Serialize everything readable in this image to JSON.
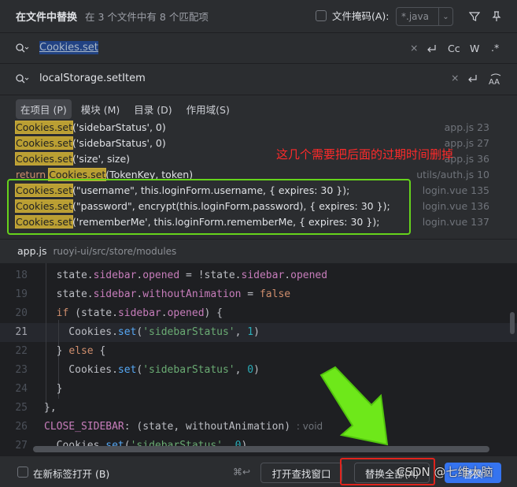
{
  "header": {
    "title": "在文件中替换",
    "subtitle": "在 3 个文件中有 8 个匹配项",
    "file_mask_label": "文件掩码(A):",
    "file_mask_value": "*.java"
  },
  "find": {
    "query": "Cookies.set",
    "options": {
      "case": "Cc",
      "words": "W",
      "regex": ".*"
    }
  },
  "replace": {
    "value": "localStorage.setItem"
  },
  "scopes": [
    {
      "label": "在项目 (P)",
      "active": true
    },
    {
      "label": "模块 (M)"
    },
    {
      "label": "目录 (D)"
    },
    {
      "label": "作用域(S)"
    }
  ],
  "results": [
    {
      "match": "Cookies.set",
      "args": "('sidebarStatus', 0)",
      "file": "app.js 23"
    },
    {
      "match": "Cookies.set",
      "args": "('sidebarStatus', 0)",
      "file": "app.js 27"
    },
    {
      "match": "Cookies.set",
      "args": "('size', size)",
      "file": "app.js 36"
    },
    {
      "prefix": "return ",
      "match": "Cookies.set",
      "args": "(TokenKey, token)",
      "file": "utils/auth.js 10"
    },
    {
      "match": "Cookies.set",
      "args": "(\"username\", this.loginForm.username, { expires: 30 });",
      "file": "login.vue 135"
    },
    {
      "match": "Cookies.set",
      "args": "(\"password\", encrypt(this.loginForm.password), { expires: 30 });",
      "file": "login.vue 136"
    },
    {
      "match": "Cookies.set",
      "args": "('rememberMe', this.loginForm.rememberMe, { expires: 30 });",
      "file": "login.vue 137"
    }
  ],
  "annotation": "这几个需要把后面的过期时间删掉",
  "preview": {
    "file": "app.js",
    "path": "ruoyi-ui/src/store/modules",
    "line_numbers": [
      "18",
      "19",
      "20",
      "21",
      "22",
      "23",
      "24",
      "25",
      "26",
      "27"
    ],
    "current_line": "21",
    "inlay_hint": ": void"
  },
  "footer": {
    "new_tab_label": "在新标签打开 (B)",
    "shortcut": "⌘↩",
    "open_find_window": "打开查找窗口",
    "replace_all": "替换全部(A)",
    "replace": "替换"
  },
  "watermark": "CSDN @七维大脑",
  "colors": {
    "accent": "#3574f0",
    "match_highlight": "#ba9f33",
    "annotation_red": "#ff2a2a",
    "box_green": "#66d31c"
  }
}
